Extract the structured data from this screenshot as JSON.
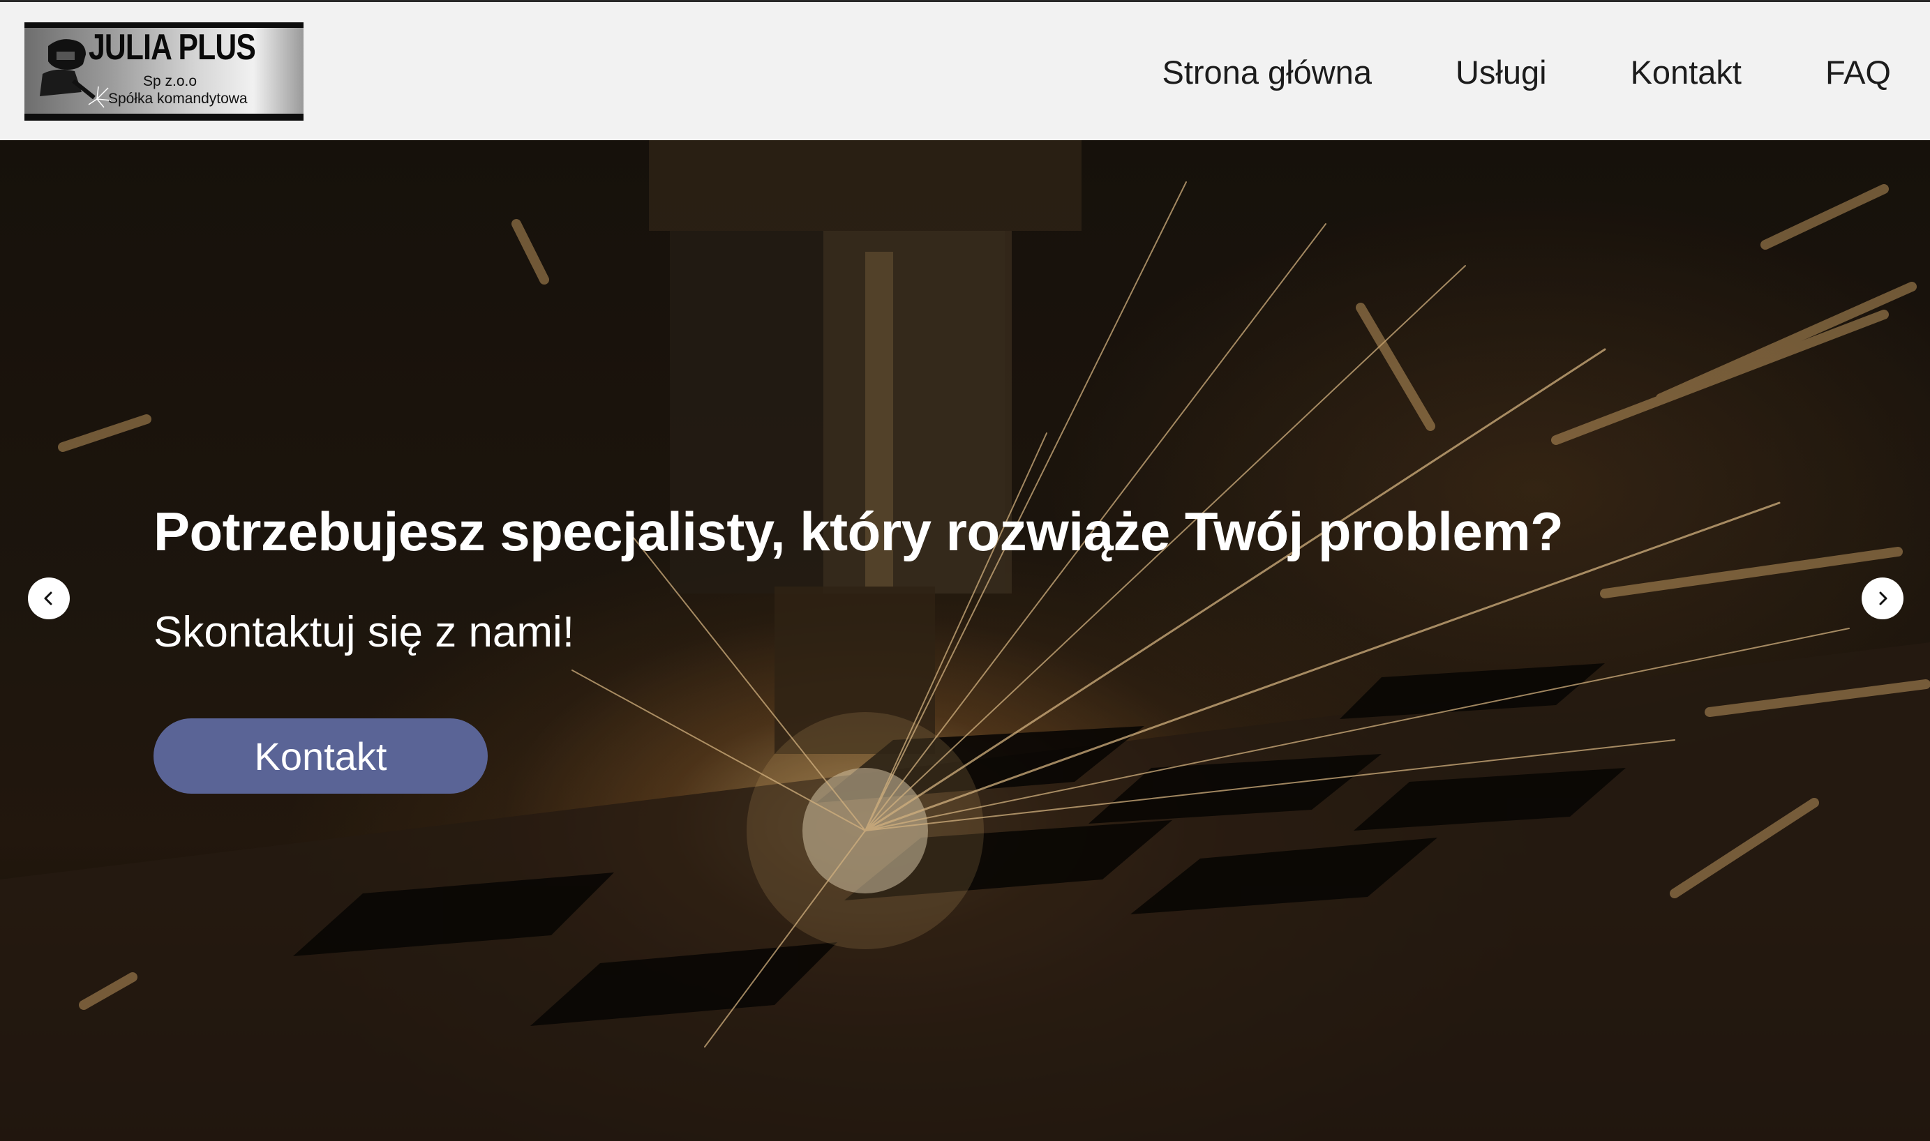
{
  "brand": {
    "name": "JULIA PLUS",
    "line1": "Sp z.o.o",
    "line2": "Spółka komandytowa",
    "logo_icon": "welder-icon"
  },
  "nav": {
    "items": [
      {
        "label": "Strona główna"
      },
      {
        "label": "Usługi"
      },
      {
        "label": "Kontakt"
      },
      {
        "label": "FAQ"
      }
    ]
  },
  "hero": {
    "title": "Potrzebujesz specjalisty, który rozwiąże Twój problem?",
    "subtitle": "Skontaktuj się z nami!",
    "cta_label": "Kontakt",
    "prev_icon": "chevron-left-icon",
    "next_icon": "chevron-right-icon",
    "background": "sparks-metal-cutting-photo"
  },
  "colors": {
    "navbar_bg": "#f2f2f2",
    "cta_bg": "#5a6496",
    "text_dark": "#1c1c1c",
    "text_light": "#ffffff"
  }
}
